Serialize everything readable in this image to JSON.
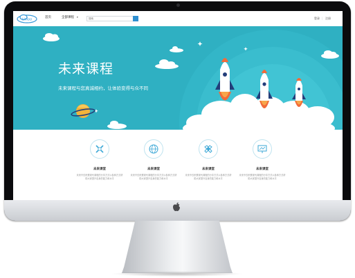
{
  "nav": {
    "logo_text": "Unioo",
    "items": [
      "首页",
      "全部课程"
    ],
    "search_placeholder": "搜索",
    "login": "登录",
    "register": "注册"
  },
  "hero": {
    "title": "未来课程",
    "subtitle": "未来课程与您真诚相约，让体验变得与众不同"
  },
  "features": [
    {
      "icon": "pencil-ruler-icon",
      "title": "未来课堂",
      "desc": "未来不仅积累现代课程的分享方式以各种方式帮助大家提升自身的能力和水平"
    },
    {
      "icon": "globe-icon",
      "title": "未来课堂",
      "desc": "未来不仅积累现代课程的分享方式以各种方式帮助大家提升自身的能力和水平"
    },
    {
      "icon": "tools-icon",
      "title": "未来课堂",
      "desc": "未来不仅积累现代课程的分享方式以各种方式帮助大家提升自身的能力和水平"
    },
    {
      "icon": "presentation-board-icon",
      "title": "未来课堂",
      "desc": "未来不仅积累现代课程的分享方式以各种方式帮助大家提升自身的能力和水平"
    }
  ],
  "colors": {
    "hero_bg": "#2fb0c2",
    "accent": "#2f8fd0",
    "rocket_flame": "#f26b3a"
  }
}
